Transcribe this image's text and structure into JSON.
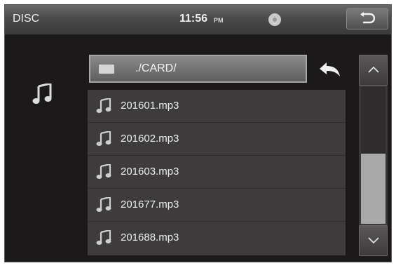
{
  "header": {
    "source": "DISC",
    "time": "11:56",
    "ampm": "PM"
  },
  "icons": {
    "back": "return-arrow-icon",
    "disc": "disc-icon",
    "music": "music-note-icon",
    "folder": "folder-icon",
    "up_folder": "curved-arrow-icon",
    "scroll_up": "chevron-up-icon",
    "scroll_down": "chevron-down-icon"
  },
  "browser": {
    "path": "./CARD/",
    "files": [
      {
        "name": "201601.mp3"
      },
      {
        "name": "201602.mp3"
      },
      {
        "name": "201603.mp3"
      },
      {
        "name": "201677.mp3"
      },
      {
        "name": "201688.mp3"
      }
    ]
  },
  "scroll": {
    "position": 0.8
  }
}
